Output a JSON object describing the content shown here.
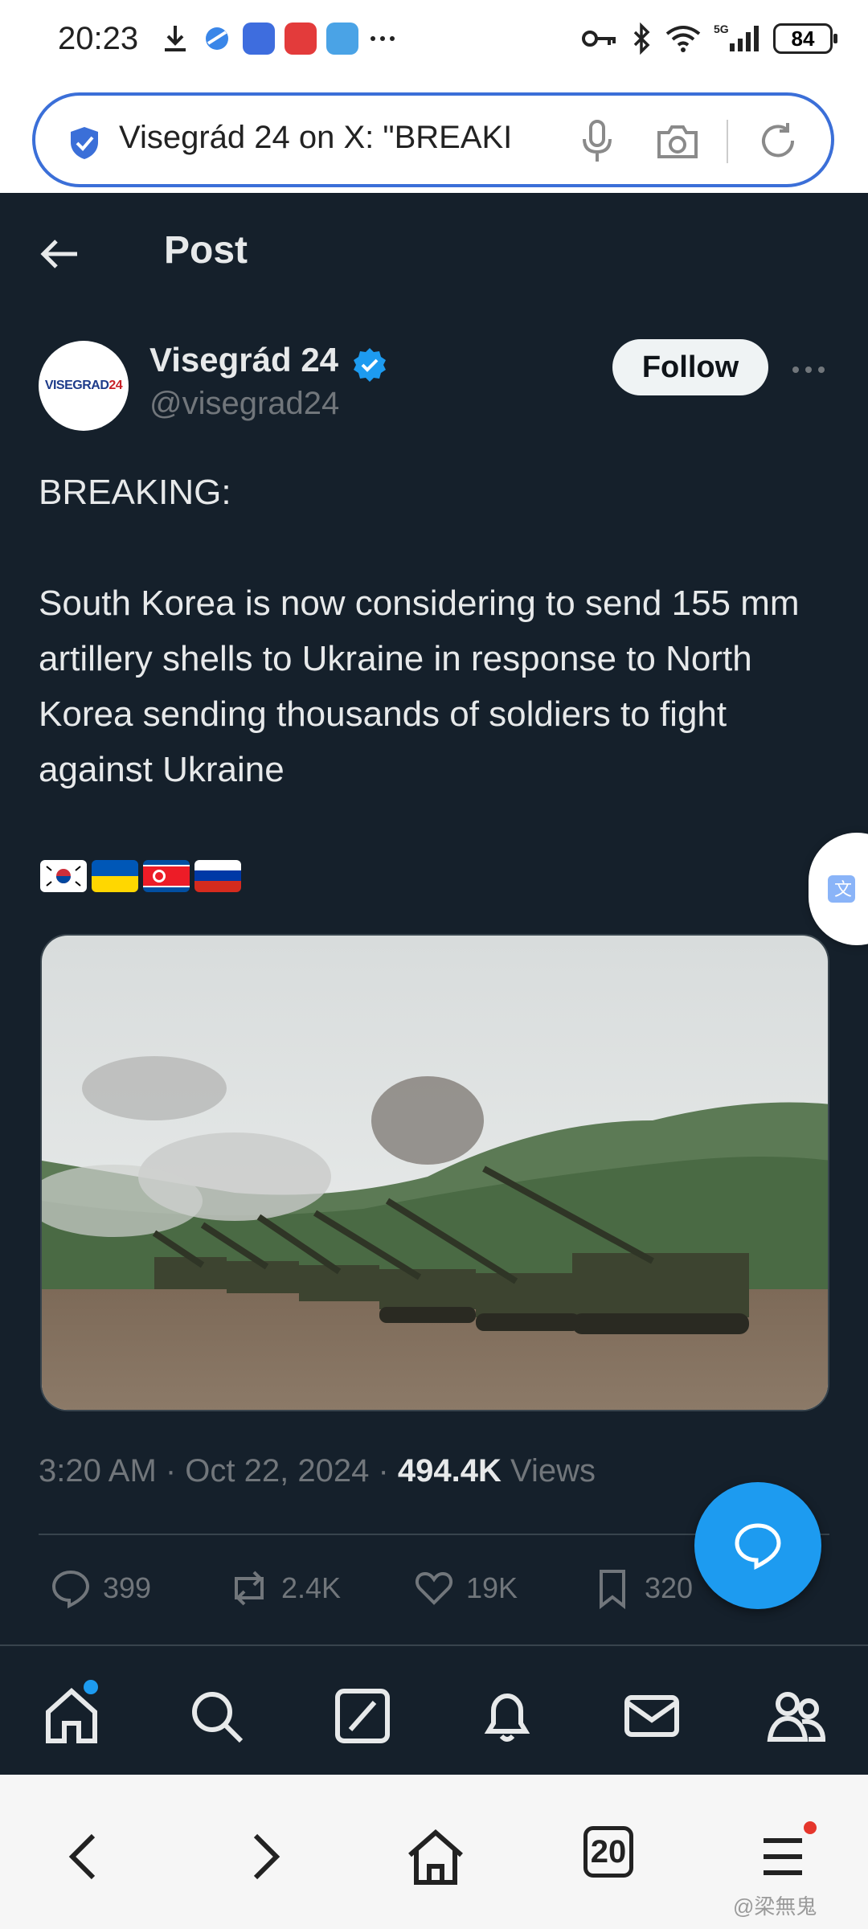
{
  "status_bar": {
    "time": "20:23",
    "battery": "84",
    "network": "5G"
  },
  "browser": {
    "url_text": "Visegrád 24 on X: \"BREAKI",
    "tabs_count": "20"
  },
  "post": {
    "header_title": "Post",
    "author_name": "Visegrád 24",
    "author_handle": "@visegrad24",
    "avatar_text_a": "VISEGRAD",
    "avatar_text_b": "24",
    "follow_label": "Follow",
    "text_line1": "BREAKING:",
    "text_body": "South Korea is now considering to send 155 mm artillery shells to Ukraine in response to North Korea sending thousands of soldiers to fight against Ukraine",
    "timestamp": "3:20 AM · Oct 22, 2024 · ",
    "views_count": "494.4K",
    "views_label": " Views",
    "stats": {
      "replies": "399",
      "reposts": "2.4K",
      "likes": "19K",
      "bookmarks": "320"
    }
  },
  "icons": {
    "back": "back-arrow-icon",
    "verified": "verified-badge-icon",
    "more": "more-icon",
    "reply": "reply-icon",
    "repost": "repost-icon",
    "like": "heart-icon",
    "bookmark": "bookmark-icon",
    "share": "share-icon",
    "compose_fab": "compose-reply-icon",
    "tabs": [
      "home-icon",
      "search-icon",
      "grok-icon",
      "notifications-icon",
      "messages-icon",
      "communities-icon"
    ],
    "browser_nav": [
      "back-icon",
      "forward-icon",
      "home-icon",
      "tabs-icon",
      "menu-icon"
    ]
  },
  "colors": {
    "app_bg": "#15202b",
    "accent": "#1d9bf0",
    "text_primary": "#e7e9ea",
    "text_secondary": "#71767b",
    "url_border": "#3b6fd8"
  },
  "watermark": "@梁無鬼"
}
